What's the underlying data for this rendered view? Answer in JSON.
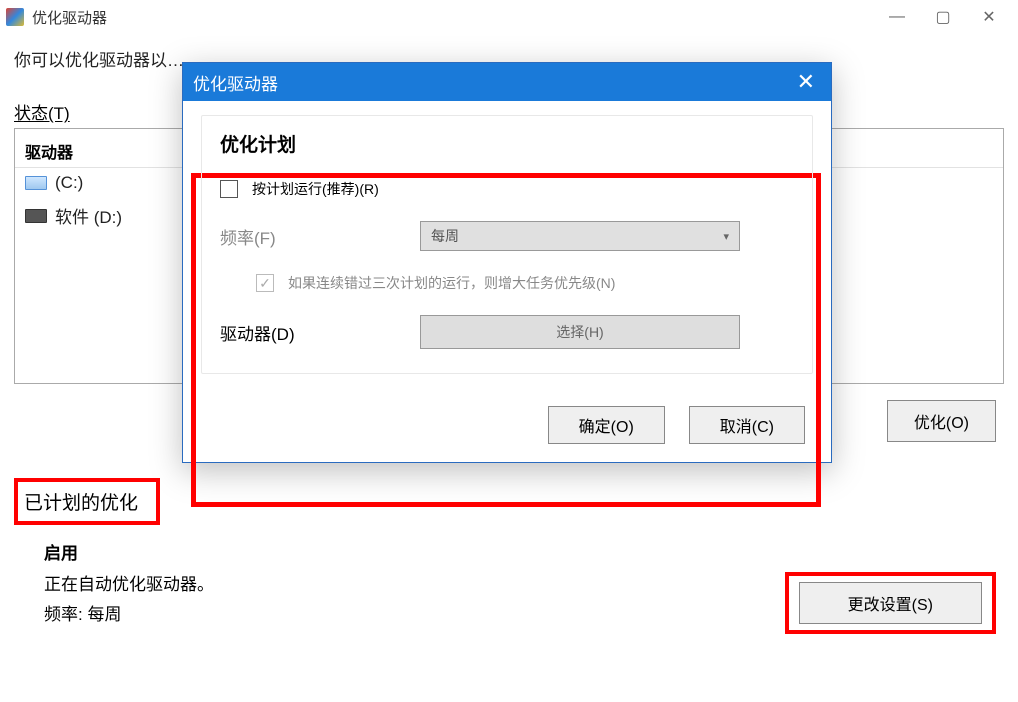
{
  "window": {
    "title": "优化驱动器",
    "intro": "你可以优化驱动器以…"
  },
  "status_label": "状态(T)",
  "drives": {
    "header": "驱动器",
    "rows": [
      {
        "label": "(C:)"
      },
      {
        "label": "软件 (D:)"
      }
    ]
  },
  "optimize_btn": "优化(O)",
  "scheduled": {
    "box_title": "已计划的优化",
    "enabled": "启用",
    "auto_line": "正在自动优化驱动器。",
    "freq_line": "频率: 每周"
  },
  "change_settings_btn": "更改设置(S)",
  "dialog": {
    "title": "优化驱动器",
    "section_title": "优化计划",
    "run_on_schedule": "按计划运行(推荐)(R)",
    "freq_label": "频率(F)",
    "freq_value": "每周",
    "boost_label": "如果连续错过三次计划的运行，则增大任务优先级(N)",
    "drives_label": "驱动器(D)",
    "choose_btn": "选择(H)",
    "ok": "确定(O)",
    "cancel": "取消(C)"
  }
}
